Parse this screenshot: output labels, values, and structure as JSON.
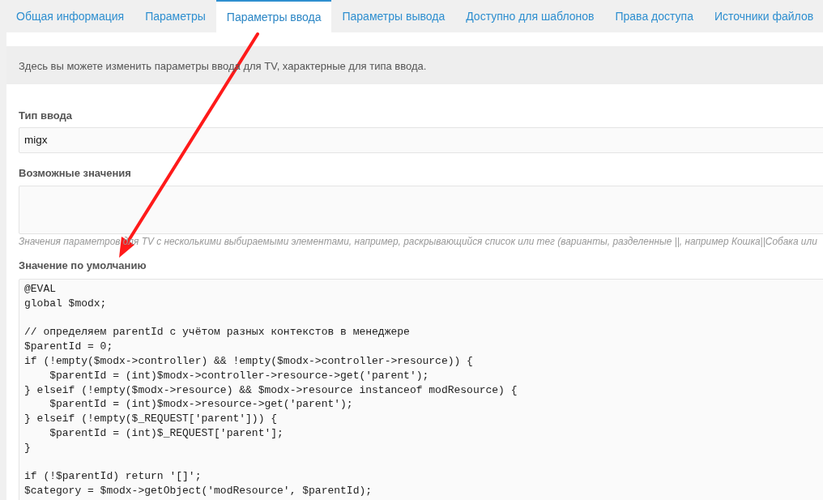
{
  "tabs": [
    {
      "label": "Общая информация",
      "selected": false
    },
    {
      "label": "Параметры",
      "selected": false
    },
    {
      "label": "Параметры ввода",
      "selected": true
    },
    {
      "label": "Параметры вывода",
      "selected": false
    },
    {
      "label": "Доступно для шаблонов",
      "selected": false
    },
    {
      "label": "Права доступа",
      "selected": false
    },
    {
      "label": "Источники файлов",
      "selected": false
    }
  ],
  "info": "Здесь вы можете изменить параметры ввода для TV, характерные для типа ввода.",
  "input_type": {
    "label": "Тип ввода",
    "value": "migx"
  },
  "possible_values": {
    "label": "Возможные значения",
    "hint": "Значения параметров для TV с несколькими выбираемыми элементами, например, раскрывающийся список или тег (варианты, разделенные ||, например Кошка||Собака или"
  },
  "default_value": {
    "label": "Значение по умолчанию",
    "value": "@EVAL\nglobal $modx;\n\n// определяем parentId с учётом разных контекстов в менеджере\n$parentId = 0;\nif (!empty($modx->controller) && !empty($modx->controller->resource)) {\n    $parentId = (int)$modx->controller->resource->get('parent');\n} elseif (!empty($modx->resource) && $modx->resource instanceof modResource) {\n    $parentId = (int)$modx->resource->get('parent');\n} elseif (!empty($_REQUEST['parent'])) {\n    $parentId = (int)$_REQUEST['parent'];\n}\n\nif (!$parentId) return '[]';\n$category = $modx->getObject('modResource', $parentId);"
  }
}
